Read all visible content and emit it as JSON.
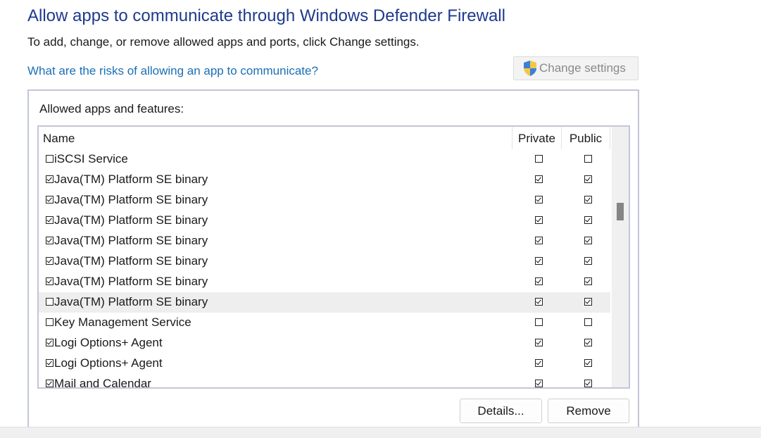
{
  "page": {
    "title": "Allow apps to communicate through Windows Defender Firewall",
    "subtitle": "To add, change, or remove allowed apps and ports, click Change settings.",
    "risk_link": "What are the risks of allowing an app to communicate?",
    "change_settings_label": "Change settings"
  },
  "allowed": {
    "group_label": "Allowed apps and features:",
    "columns": {
      "name": "Name",
      "private": "Private",
      "public": "Public"
    },
    "rows": [
      {
        "name": "iSCSI Service",
        "enabled": false,
        "private": false,
        "public": false,
        "selected": false
      },
      {
        "name": "Java(TM) Platform SE binary",
        "enabled": true,
        "private": true,
        "public": true,
        "selected": false
      },
      {
        "name": "Java(TM) Platform SE binary",
        "enabled": true,
        "private": true,
        "public": true,
        "selected": false
      },
      {
        "name": "Java(TM) Platform SE binary",
        "enabled": true,
        "private": true,
        "public": true,
        "selected": false
      },
      {
        "name": "Java(TM) Platform SE binary",
        "enabled": true,
        "private": true,
        "public": true,
        "selected": false
      },
      {
        "name": "Java(TM) Platform SE binary",
        "enabled": true,
        "private": true,
        "public": true,
        "selected": false
      },
      {
        "name": "Java(TM) Platform SE binary",
        "enabled": true,
        "private": true,
        "public": true,
        "selected": false
      },
      {
        "name": "Java(TM) Platform SE binary",
        "enabled": false,
        "private": true,
        "public": true,
        "selected": true
      },
      {
        "name": "Key Management Service",
        "enabled": false,
        "private": false,
        "public": false,
        "selected": false
      },
      {
        "name": "Logi Options+ Agent",
        "enabled": true,
        "private": true,
        "public": true,
        "selected": false
      },
      {
        "name": "Logi Options+ Agent",
        "enabled": true,
        "private": true,
        "public": true,
        "selected": false
      },
      {
        "name": "Mail and Calendar",
        "enabled": true,
        "private": true,
        "public": true,
        "selected": false
      }
    ]
  },
  "buttons": {
    "details": "Details...",
    "remove": "Remove"
  },
  "colors": {
    "title": "#1e3a8c",
    "link": "#1a6fb5",
    "border": "#c3c6d8",
    "selected_row": "#eeeeee"
  },
  "icons": {
    "change_settings": "uac-shield-icon"
  }
}
